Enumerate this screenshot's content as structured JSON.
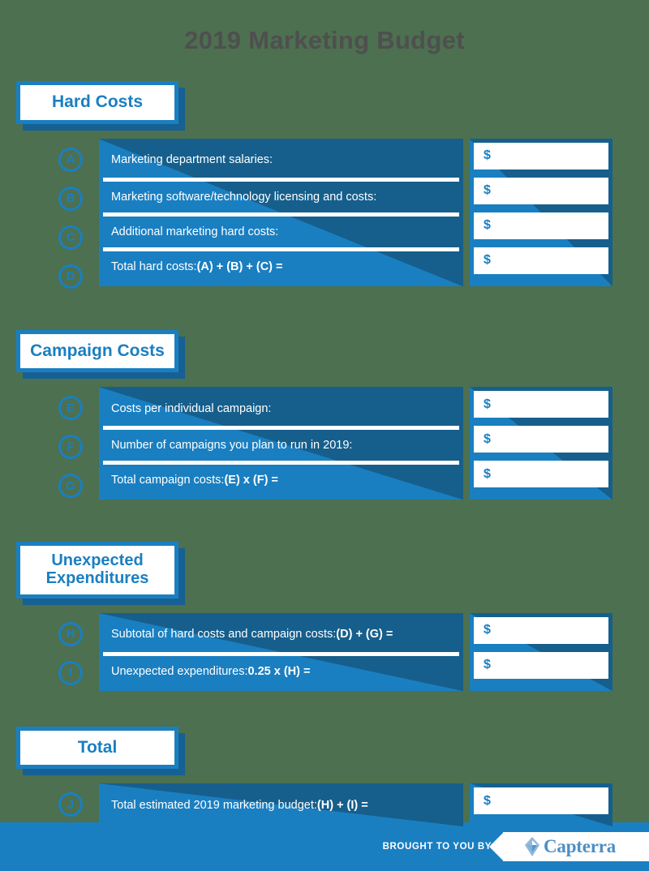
{
  "title": "2019 Marketing Budget",
  "currency_symbol": "$",
  "colors": {
    "background": "#4c7050",
    "accent_blue": "#1a7fc1",
    "dark_blue": "#165f8c",
    "shadow_blue": "#176093",
    "title_gray": "#4f4f4f",
    "white": "#ffffff",
    "capterra_blue": "#4e8fc4"
  },
  "sections": [
    {
      "badge": "Hard Costs",
      "rows": [
        {
          "letter": "A",
          "label": "Marketing department salaries:",
          "bold": ""
        },
        {
          "letter": "B",
          "label": "Marketing software/technology licensing and costs:",
          "bold": ""
        },
        {
          "letter": "C",
          "label": "Additional marketing hard costs:",
          "bold": ""
        },
        {
          "letter": "D",
          "label": "Total hard costs: ",
          "bold": "(A) + (B) + (C) ="
        }
      ]
    },
    {
      "badge": "Campaign Costs",
      "rows": [
        {
          "letter": "E",
          "label": "Costs per individual campaign:",
          "bold": ""
        },
        {
          "letter": "F",
          "label": "Number of campaigns you plan to run in 2019:",
          "bold": ""
        },
        {
          "letter": "G",
          "label": "Total campaign costs: ",
          "bold": "(E) x (F) ="
        }
      ]
    },
    {
      "badge": "Unexpected Expenditures",
      "badge_line_1": "Unexpected",
      "badge_line_2": "Expenditures",
      "rows": [
        {
          "letter": "H",
          "label": "Subtotal of hard costs and campaign costs: ",
          "bold": "(D) + (G) ="
        },
        {
          "letter": "I",
          "label": "Unexpected expenditures: ",
          "bold": "0.25 x (H) ="
        }
      ]
    },
    {
      "badge": "Total",
      "rows": [
        {
          "letter": "J",
          "label": "Total estimated 2019 marketing budget: ",
          "bold": "(H) + (I) ="
        }
      ]
    }
  ],
  "footer": {
    "brought_to_you_by": "BROUGHT TO YOU BY",
    "brand": "Capterra"
  }
}
